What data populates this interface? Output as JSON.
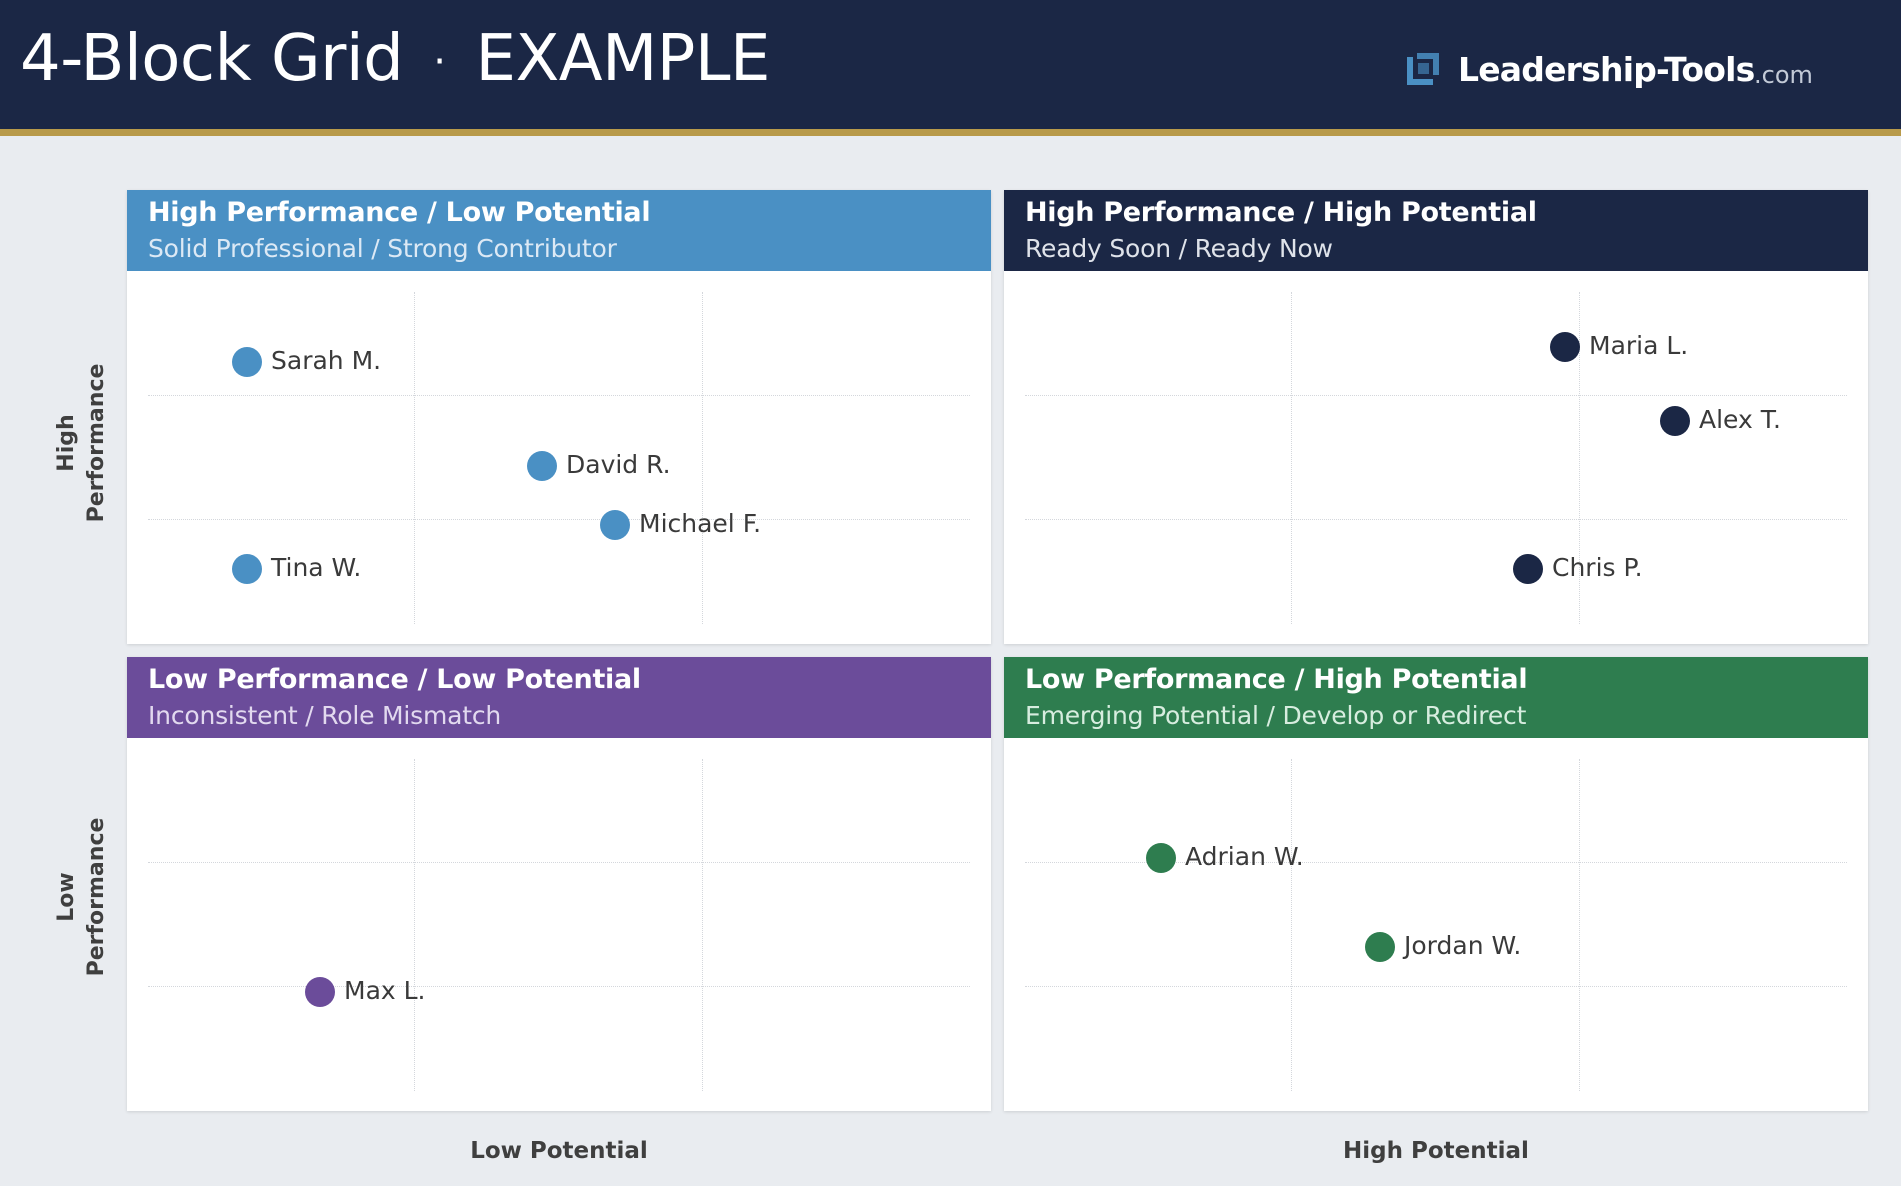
{
  "header": {
    "title": "4-Block Grid",
    "separator": "·",
    "subtitle": "EXAMPLE",
    "logo_name": "Leadership-Tools",
    "logo_domain": ".com"
  },
  "axes": {
    "y_high_line1": "High",
    "y_high_line2": "Performance",
    "y_low_line1": "Low",
    "y_low_line2": "Performance",
    "x_low": "Low Potential",
    "x_high": "High Potential"
  },
  "colors": {
    "header_bg": "#1b2745",
    "header_rule": "#b89a4a",
    "page_bg": "#e9ecf0",
    "blue": "#4a90c4",
    "navy": "#1b2745",
    "purple": "#6b4c9a",
    "green": "#2e7d4f"
  },
  "quadrants": [
    {
      "id": "tl",
      "title": "High Performance / Low Potential",
      "subtitle": "Solid Professional / Strong Contributor",
      "color": "#4a90c4",
      "subtitle_color": "#dce9f5",
      "people": [
        {
          "name": "Sarah M."
        },
        {
          "name": "David R."
        },
        {
          "name": "Michael F."
        },
        {
          "name": "Tina W."
        }
      ]
    },
    {
      "id": "tr",
      "title": "High Performance / High Potential",
      "subtitle": "Ready Soon / Ready Now",
      "color": "#1b2745",
      "subtitle_color": "#dfe3ea",
      "people": [
        {
          "name": "Maria L."
        },
        {
          "name": "Alex T."
        },
        {
          "name": "Chris P."
        }
      ]
    },
    {
      "id": "bl",
      "title": "Low Performance / Low Potential",
      "subtitle": "Inconsistent / Role Mismatch",
      "color": "#6b4c9a",
      "subtitle_color": "#e2d9ef",
      "people": [
        {
          "name": "Max L."
        }
      ]
    },
    {
      "id": "br",
      "title": "Low Performance / High Potential",
      "subtitle": "Emerging Potential / Develop or Redirect",
      "color": "#2e7d4f",
      "subtitle_color": "#d7eddf",
      "people": [
        {
          "name": "Adrian W."
        },
        {
          "name": "Jordan W."
        }
      ]
    }
  ]
}
